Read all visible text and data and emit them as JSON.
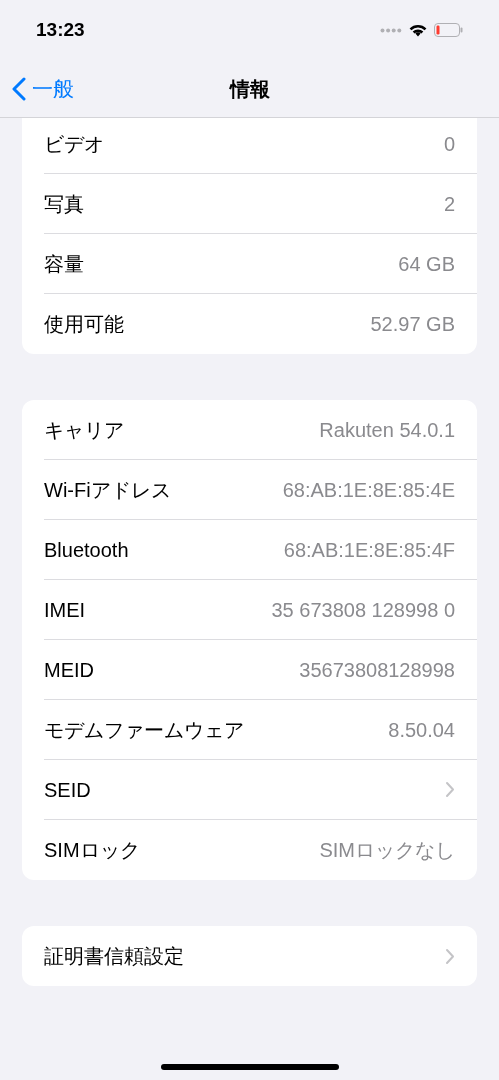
{
  "status_bar": {
    "time": "13:23"
  },
  "nav": {
    "back": "一般",
    "title": "情報"
  },
  "groups": [
    {
      "cut_top": true,
      "rows": [
        {
          "kind": "value",
          "label": "ビデオ",
          "value": "0"
        },
        {
          "kind": "value",
          "label": "写真",
          "value": "2"
        },
        {
          "kind": "value",
          "label": "容量",
          "value": "64 GB"
        },
        {
          "kind": "value",
          "label": "使用可能",
          "value": "52.97 GB"
        }
      ]
    },
    {
      "cut_top": false,
      "rows": [
        {
          "kind": "value",
          "label": "キャリア",
          "value": "Rakuten 54.0.1"
        },
        {
          "kind": "value",
          "label": "Wi-Fiアドレス",
          "value": "68:AB:1E:8E:85:4E"
        },
        {
          "kind": "value",
          "label": "Bluetooth",
          "value": "68:AB:1E:8E:85:4F"
        },
        {
          "kind": "value",
          "label": "IMEI",
          "value": "35 673808 128998 0"
        },
        {
          "kind": "value",
          "label": "MEID",
          "value": "35673808128998"
        },
        {
          "kind": "value",
          "label": "モデムファームウェア",
          "value": "8.50.04"
        },
        {
          "kind": "link",
          "label": "SEID"
        },
        {
          "kind": "value",
          "label": "SIMロック",
          "value": "SIMロックなし"
        }
      ]
    },
    {
      "cut_top": false,
      "rows": [
        {
          "kind": "link",
          "label": "証明書信頼設定"
        }
      ]
    }
  ]
}
